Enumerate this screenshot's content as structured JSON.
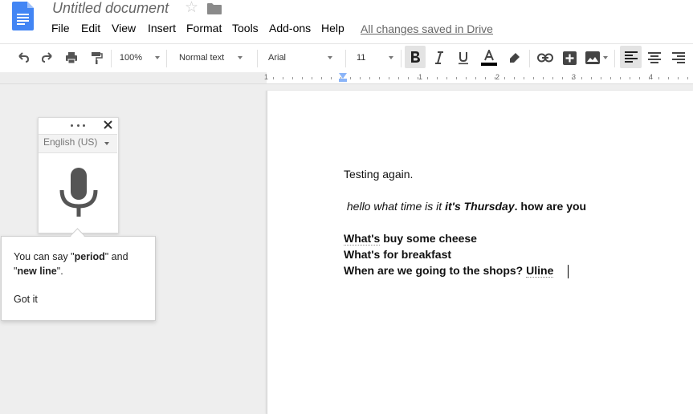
{
  "header": {
    "title": "Untitled document",
    "saved_status": "All changes saved in Drive",
    "menu": [
      "File",
      "Edit",
      "View",
      "Insert",
      "Format",
      "Tools",
      "Add-ons",
      "Help"
    ]
  },
  "toolbar": {
    "zoom": "100%",
    "style": "Normal text",
    "font": "Arial",
    "font_size": "11"
  },
  "ruler": {
    "numbers": [
      "1",
      "1",
      "2",
      "3",
      "4"
    ]
  },
  "voice_typing": {
    "language": "English (US)",
    "tip_prefix": "You can say \"",
    "tip_period": "period",
    "tip_middle": "\" and \"",
    "tip_newline": "new line",
    "tip_suffix": "\".",
    "got_it": "Got it"
  },
  "document": {
    "line1": "Testing again.",
    "line2_italic": " hello what time is it ",
    "line2_bold_italic": "it's Thursday",
    "line2_bold": ". how are you",
    "line3_a": "What's",
    "line3_b": " buy some cheese",
    "line4_a": "What's",
    "line4_b": " for breakfast",
    "line5_a": "When are we going to the shops? ",
    "line5_b": "Uline"
  },
  "colors": {
    "doc_icon": "#4285f4",
    "indent_marker": "#8ab4f8",
    "canvas": "#eeeeee"
  }
}
